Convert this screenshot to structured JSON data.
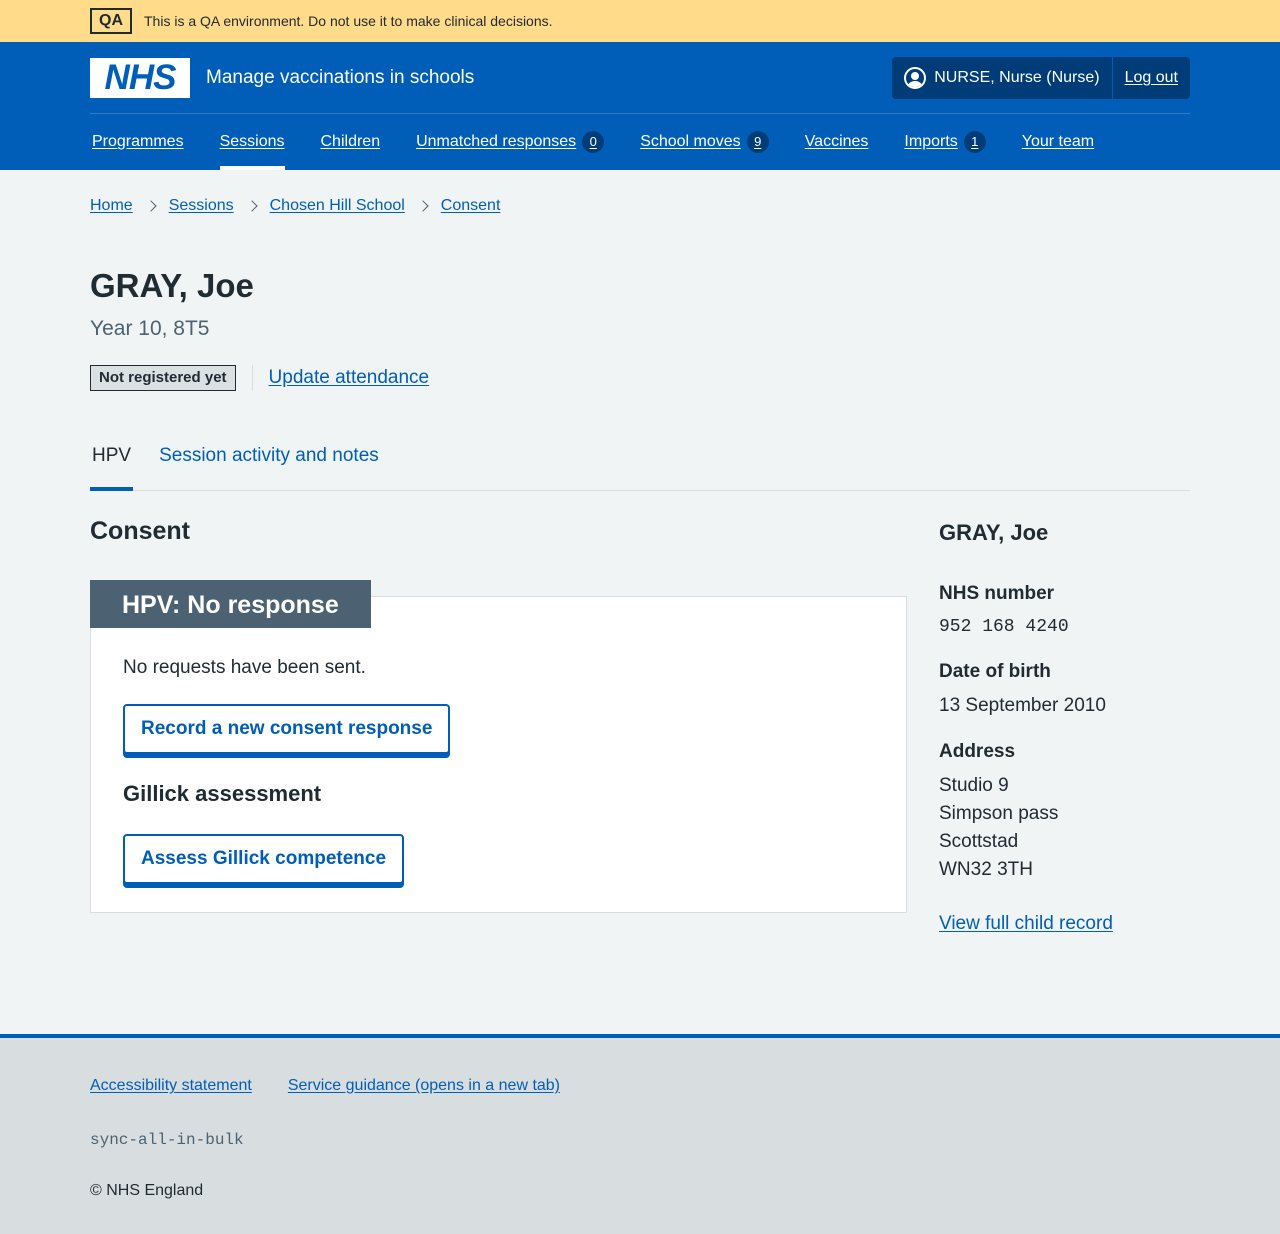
{
  "qa_banner": {
    "tag": "QA",
    "text": "This is a QA environment. Do not use it to make clinical decisions."
  },
  "header": {
    "logo": "NHS",
    "service_name": "Manage vaccinations in schools",
    "user": "NURSE, Nurse (Nurse)",
    "logout": "Log out",
    "user_icon": "user-icon"
  },
  "nav": [
    {
      "label": "Programmes"
    },
    {
      "label": "Sessions",
      "active": true
    },
    {
      "label": "Children"
    },
    {
      "label": "Unmatched responses",
      "count": "0"
    },
    {
      "label": "School moves",
      "count": "9"
    },
    {
      "label": "Vaccines"
    },
    {
      "label": "Imports",
      "count": "1"
    },
    {
      "label": "Your team"
    }
  ],
  "breadcrumb": [
    "Home",
    "Sessions",
    "Chosen Hill School",
    "Consent"
  ],
  "page": {
    "title": "GRAY, Joe",
    "caption": "Year 10, 8T5",
    "status_tag": "Not registered yet",
    "update_attendance": "Update attendance"
  },
  "tabs": [
    {
      "label": "HPV",
      "active": true
    },
    {
      "label": "Session activity and notes"
    }
  ],
  "consent": {
    "section_title": "Consent",
    "card_title": "HPV: No response",
    "message": "No requests have been sent.",
    "record_button": "Record a new consent response",
    "gillick_heading": "Gillick assessment",
    "gillick_button": "Assess Gillick competence"
  },
  "summary": {
    "name": "GRAY, Joe",
    "nhs_number_label": "NHS number",
    "nhs_number": "952 168 4240",
    "dob_label": "Date of birth",
    "dob": "13 September 2010",
    "address_label": "Address",
    "address": [
      "Studio 9",
      "Simpson pass",
      "Scottstad",
      "WN32 3TH"
    ],
    "view_record": "View full child record"
  },
  "footer": {
    "links": [
      "Accessibility statement",
      "Service guidance (opens in a new tab)"
    ],
    "code": "sync-all-in-bulk",
    "copyright": "© NHS England"
  },
  "colors": {
    "qa_banner": "#ffdb8a",
    "nhs_blue": "#005eb8",
    "dark_blue": "#003d78",
    "card_header": "#4c6272",
    "page_bg": "#f0f4f5",
    "footer_bg": "#d8dde0"
  }
}
